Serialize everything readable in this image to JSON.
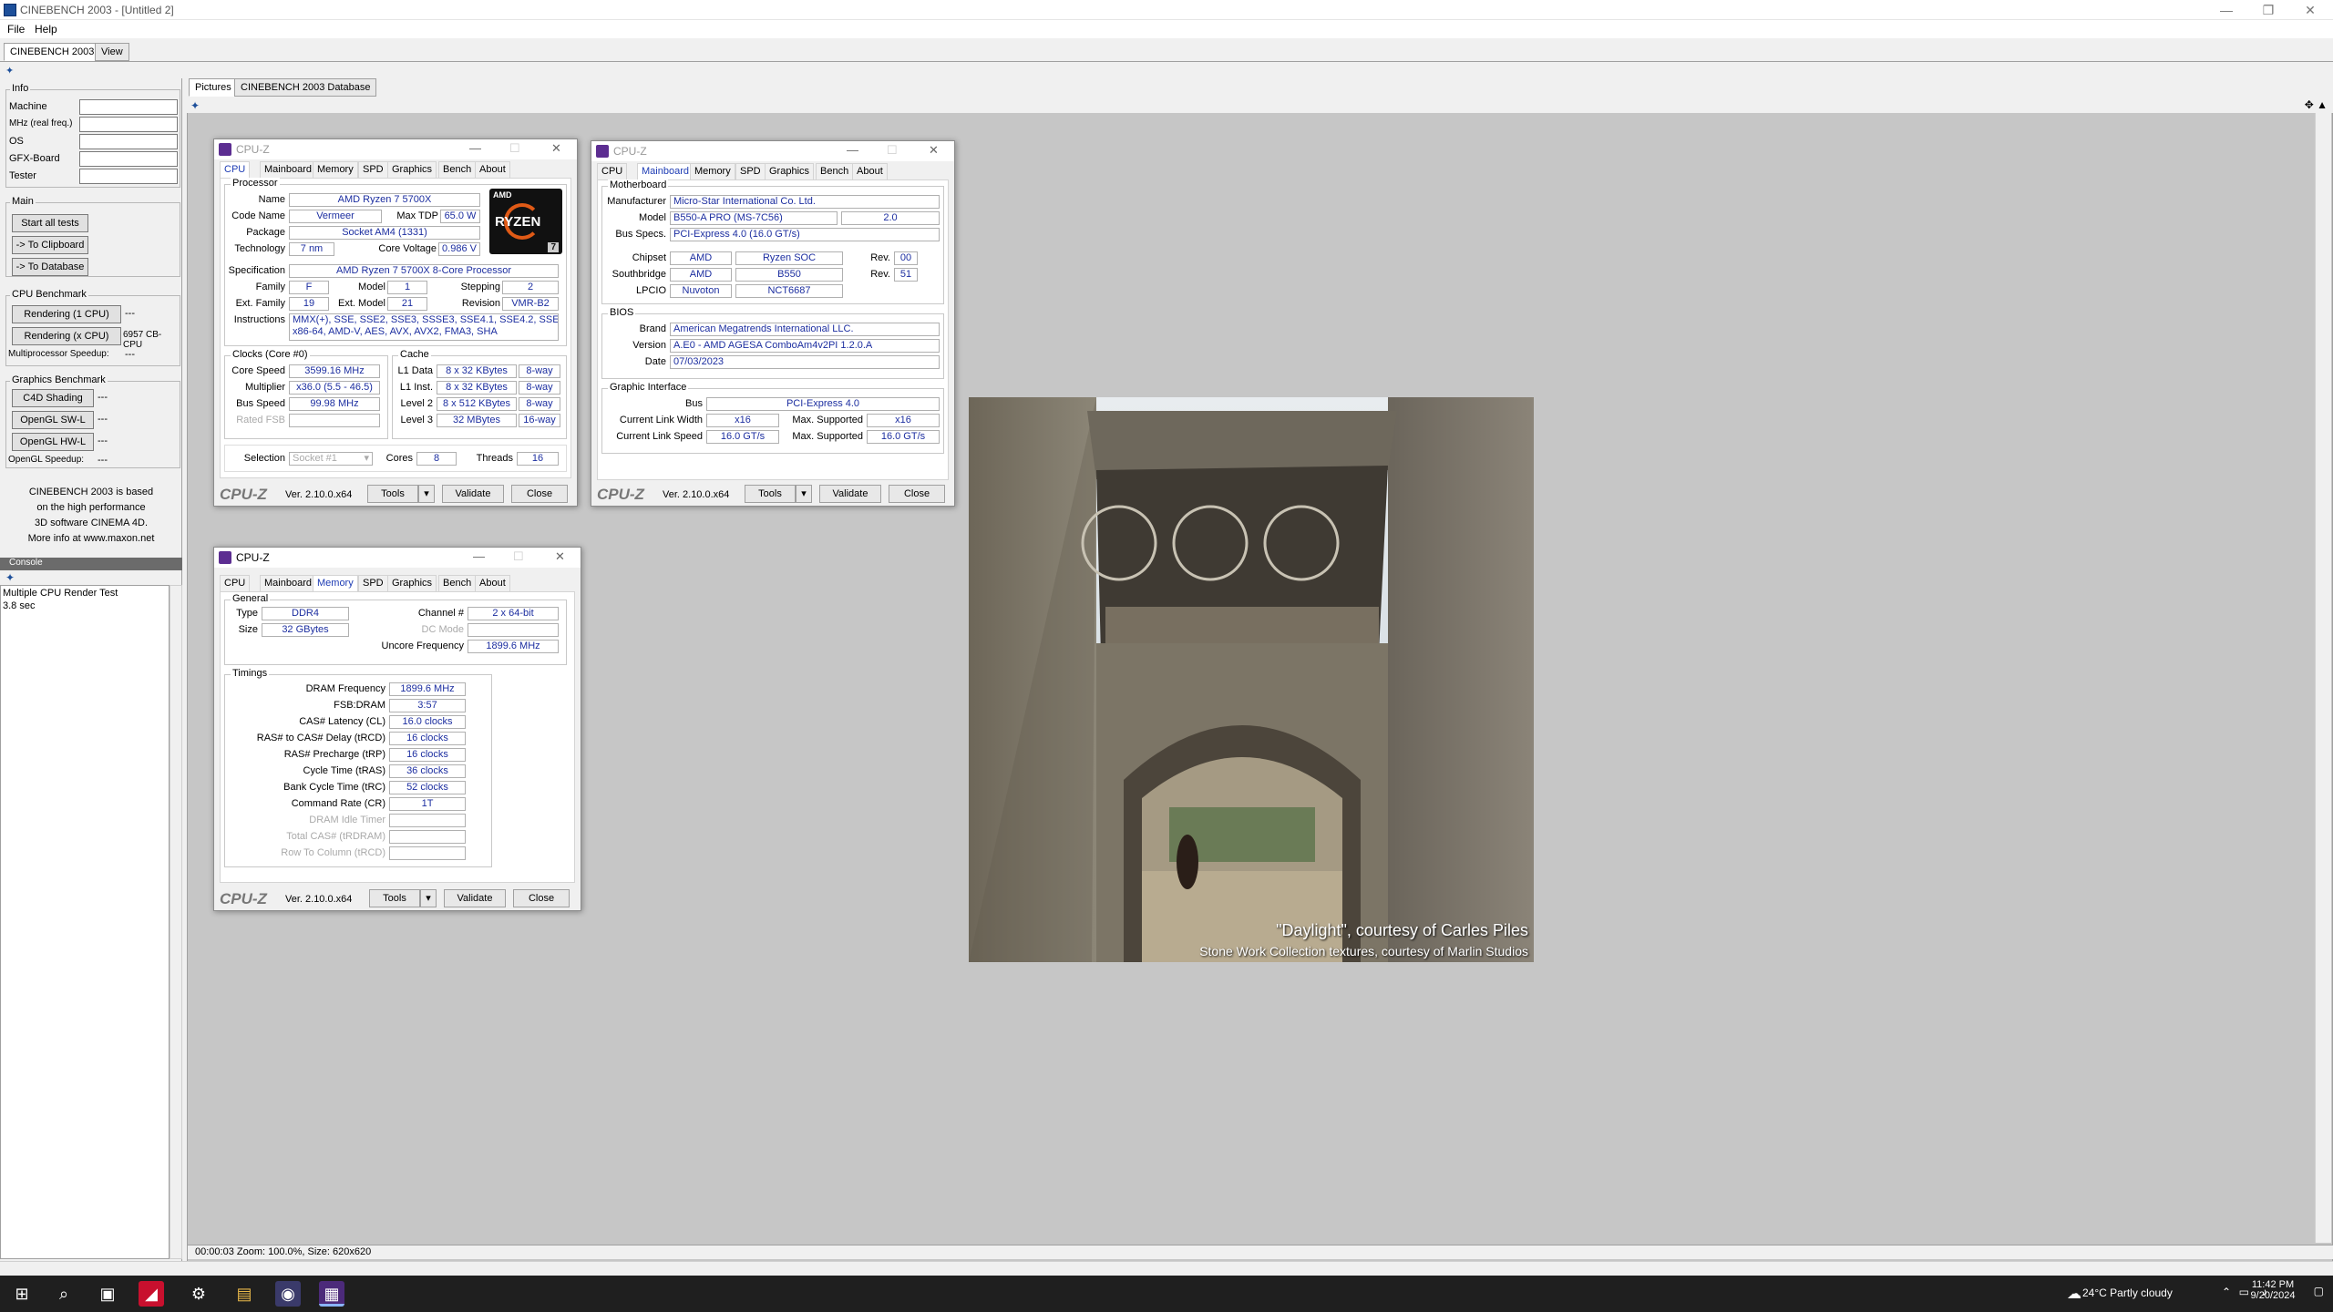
{
  "window": {
    "title": "CINEBENCH 2003 - [Untitled 2]",
    "minimize": "—",
    "restore": "❐",
    "close": "✕"
  },
  "menu": [
    "File",
    "Help"
  ],
  "main_tabs": [
    "CINEBENCH 2003",
    "View"
  ],
  "info": {
    "label": "Info",
    "fields": [
      "Machine",
      "MHz (real freq.)",
      "OS",
      "GFX-Board",
      "Tester"
    ]
  },
  "main_group": {
    "label": "Main",
    "start": "Start all tests",
    "clipboard": "-> To Clipboard",
    "database": "-> To Database"
  },
  "cpu_bench": {
    "label": "CPU Benchmark",
    "r1": "Rendering (1 CPU)",
    "r1_val": "---",
    "rx": "Rendering (x CPU)",
    "rx_val": "6957 CB-CPU",
    "mp": "Multiprocessor Speedup:",
    "mp_val": "---"
  },
  "gfx_bench": {
    "label": "Graphics Benchmark",
    "c4d": "C4D Shading",
    "sw": "OpenGL SW-L",
    "hw": "OpenGL HW-L",
    "dash": "---",
    "ogl": "OpenGL Speedup:",
    "ogl_val": "---"
  },
  "about_text": [
    "CINEBENCH 2003 is based",
    "on the high performance",
    "3D software CINEMA 4D.",
    "More info at www.maxon.net"
  ],
  "console": {
    "header": "Console",
    "lines": [
      "Multiple CPU Render Test",
      "3.8 sec"
    ]
  },
  "picture_tabs": [
    "Pictures",
    "CINEBENCH 2003 Database"
  ],
  "status": "00:00:03  Zoom: 100.0%, Size: 620x620",
  "render": {
    "caption1": "\"Daylight\", courtesy of Carles Piles",
    "caption2": "Stone Work Collection textures, courtesy of Marlin Studios"
  },
  "cpuz_common": {
    "title": "CPU-Z",
    "tabs": [
      "CPU",
      "Mainboard",
      "Memory",
      "SPD",
      "Graphics",
      "Bench",
      "About"
    ],
    "logo": "CPU-Z",
    "version": "Ver. 2.10.0.x64",
    "tools": "Tools",
    "validate": "Validate",
    "close": "Close"
  },
  "cpuz_cpu": {
    "processor_label": "Processor",
    "name_k": "Name",
    "name": "AMD Ryzen 7 5700X",
    "code_k": "Code Name",
    "code": "Vermeer",
    "tdp_k": "Max TDP",
    "tdp": "65.0 W",
    "package_k": "Package",
    "package": "Socket AM4 (1331)",
    "tech_k": "Technology",
    "tech": "7 nm",
    "volt_k": "Core Voltage",
    "volt": "0.986 V",
    "spec_k": "Specification",
    "spec": "AMD Ryzen 7 5700X 8-Core Processor",
    "family_k": "Family",
    "family": "F",
    "model_k": "Model",
    "model": "1",
    "stepping_k": "Stepping",
    "stepping": "2",
    "extfam_k": "Ext. Family",
    "extfam": "19",
    "extmodel_k": "Ext. Model",
    "extmodel": "21",
    "rev_k": "Revision",
    "rev": "VMR-B2",
    "instr_k": "Instructions",
    "instr1": "MMX(+), SSE, SSE2, SSE3, SSSE3, SSE4.1, SSE4.2, SSE4A,",
    "instr2": "x86-64, AMD-V, AES, AVX, AVX2, FMA3, SHA",
    "clocks_label": "Clocks (Core #0)",
    "cs_k": "Core Speed",
    "cs": "3599.16 MHz",
    "mul_k": "Multiplier",
    "mul": "x36.0 (5.5 - 46.5)",
    "bus_k": "Bus Speed",
    "bus": "99.98 MHz",
    "fsb_k": "Rated FSB",
    "cache_label": "Cache",
    "l1d_k": "L1 Data",
    "l1d": "8 x 32 KBytes",
    "l1d_w": "8-way",
    "l1i_k": "L1 Inst.",
    "l1i": "8 x 32 KBytes",
    "l1i_w": "8-way",
    "l2_k": "Level 2",
    "l2": "8 x 512 KBytes",
    "l2_w": "8-way",
    "l3_k": "Level 3",
    "l3": "32 MBytes",
    "l3_w": "16-way",
    "sel_k": "Selection",
    "sel": "Socket #1",
    "cores_k": "Cores",
    "cores": "8",
    "threads_k": "Threads",
    "threads": "16",
    "logo_text": "RYZEN",
    "logo_num": "7",
    "logo_amd": "AMD"
  },
  "cpuz_mb": {
    "mb_label": "Motherboard",
    "man_k": "Manufacturer",
    "man": "Micro-Star International Co. Ltd.",
    "model_k": "Model",
    "model": "B550-A PRO (MS-7C56)",
    "model_rev": "2.0",
    "bus_k": "Bus Specs.",
    "bus": "PCI-Express 4.0 (16.0 GT/s)",
    "chip_k": "Chipset",
    "chip": "AMD",
    "chip2": "Ryzen SOC",
    "rev_k": "Rev.",
    "chip_rev": "00",
    "sb_k": "Southbridge",
    "sb": "AMD",
    "sb2": "B550",
    "sb_rev": "51",
    "lpc_k": "LPCIO",
    "lpc": "Nuvoton",
    "lpc2": "NCT6687",
    "bios_label": "BIOS",
    "brand_k": "Brand",
    "brand": "American Megatrends International LLC.",
    "ver_k": "Version",
    "ver": "A.E0 - AMD AGESA ComboAm4v2PI 1.2.0.A",
    "date_k": "Date",
    "date": "07/03/2023",
    "gi_label": "Graphic Interface",
    "gbus_k": "Bus",
    "gbus": "PCI-Express 4.0",
    "clw_k": "Current Link Width",
    "clw": "x16",
    "maxs_k": "Max. Supported",
    "maxw": "x16",
    "cls_k": "Current Link Speed",
    "cls": "16.0 GT/s",
    "maxsp": "16.0 GT/s"
  },
  "cpuz_mem": {
    "gen_label": "General",
    "type_k": "Type",
    "type": "DDR4",
    "ch_k": "Channel #",
    "ch": "2 x 64-bit",
    "size_k": "Size",
    "size": "32 GBytes",
    "dc_k": "DC Mode",
    "unc_k": "Uncore Frequency",
    "unc": "1899.6 MHz",
    "tim_label": "Timings",
    "rows": [
      {
        "k": "DRAM Frequency",
        "v": "1899.6 MHz"
      },
      {
        "k": "FSB:DRAM",
        "v": "3:57"
      },
      {
        "k": "CAS# Latency (CL)",
        "v": "16.0 clocks"
      },
      {
        "k": "RAS# to CAS# Delay (tRCD)",
        "v": "16 clocks"
      },
      {
        "k": "RAS# Precharge (tRP)",
        "v": "16 clocks"
      },
      {
        "k": "Cycle Time (tRAS)",
        "v": "36 clocks"
      },
      {
        "k": "Bank Cycle Time (tRC)",
        "v": "52 clocks"
      },
      {
        "k": "Command Rate (CR)",
        "v": "1T"
      },
      {
        "k": "DRAM Idle Timer",
        "v": ""
      },
      {
        "k": "Total CAS# (tRDRAM)",
        "v": ""
      },
      {
        "k": "Row To Column (tRCD)",
        "v": ""
      }
    ]
  },
  "taskbar": {
    "weather": "24°C  Partly cloudy",
    "time": "11:42 PM",
    "date": "9/20/2024"
  }
}
